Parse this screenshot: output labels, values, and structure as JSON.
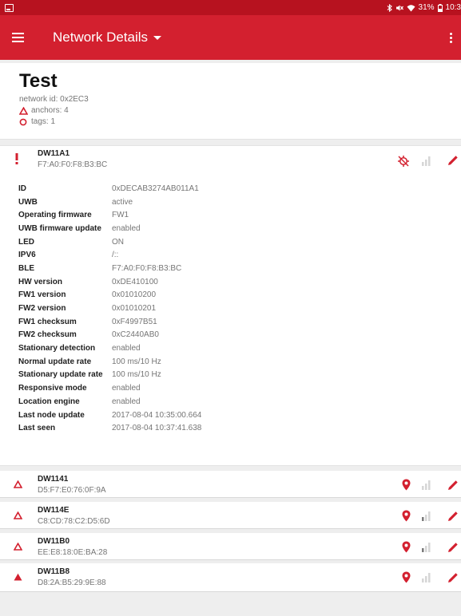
{
  "status_bar": {
    "right_text": "31%",
    "time": "10:3"
  },
  "app_bar": {
    "title": "Network Details",
    "menu_icon": "hamburger-icon",
    "overflow_icon": "more-vert-icon"
  },
  "network": {
    "name": "Test",
    "id_text": "network id: 0x2EC3",
    "anchors_text": "anchors: 4",
    "tags_text": "tags: 1",
    "accent_color": "#d3202f"
  },
  "expanded_node": {
    "name": "DW11A1",
    "mac": "F7:A0:F0:F8:B3:BC",
    "status_icon": "exclamation-icon",
    "details": [
      {
        "key": "ID",
        "value": "0xDECAB3274AB011A1"
      },
      {
        "key": "UWB",
        "value": "active"
      },
      {
        "key": "Operating firmware",
        "value": "FW1"
      },
      {
        "key": "UWB firmware update",
        "value": "enabled"
      },
      {
        "key": "LED",
        "value": "ON"
      },
      {
        "key": "IPV6",
        "value": "/::"
      },
      {
        "key": "BLE",
        "value": "F7:A0:F0:F8:B3:BC"
      },
      {
        "key": "HW version",
        "value": "0xDE410100"
      },
      {
        "key": "FW1 version",
        "value": "0x01010200"
      },
      {
        "key": "FW2 version",
        "value": "0x01010201"
      },
      {
        "key": "FW1 checksum",
        "value": "0xF4997B51"
      },
      {
        "key": "FW2 checksum",
        "value": "0xC2440AB0"
      },
      {
        "key": "Stationary detection",
        "value": "enabled"
      },
      {
        "key": "Normal update rate",
        "value": "100 ms/10 Hz"
      },
      {
        "key": "Stationary update rate",
        "value": "100 ms/10 Hz"
      },
      {
        "key": "Responsive mode",
        "value": "enabled"
      },
      {
        "key": "Location engine",
        "value": "enabled"
      },
      {
        "key": "Last node update",
        "value": "2017-08-04 10:35:00.664"
      },
      {
        "key": "Last seen",
        "value": "2017-08-04 10:37:41.638"
      }
    ]
  },
  "nodes": [
    {
      "name": "DW1141",
      "mac": "D5:F7:E0:76:0F:9A",
      "status_icon": "anchor-outline-icon"
    },
    {
      "name": "DW114E",
      "mac": "C8:CD:78:C2:D5:6D",
      "status_icon": "anchor-outline-icon"
    },
    {
      "name": "DW11B0",
      "mac": "EE:E8:18:0E:BA:28",
      "status_icon": "anchor-outline-icon"
    },
    {
      "name": "DW11B8",
      "mac": "D8:2A:B5:29:9E:88",
      "status_icon": "anchor-filled-icon"
    }
  ]
}
